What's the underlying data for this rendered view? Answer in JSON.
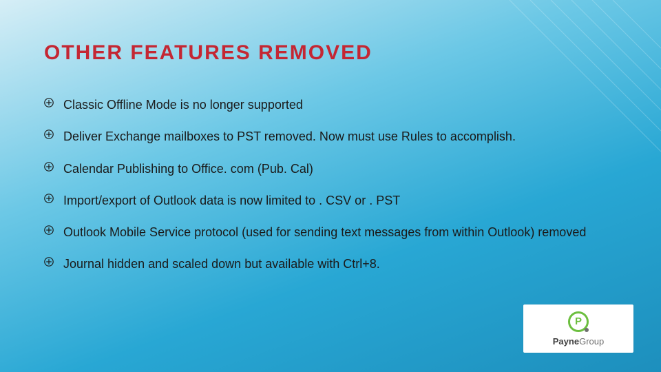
{
  "slide": {
    "title": "OTHER FEATURES REMOVED",
    "bullets": [
      "Classic Offline Mode is no longer supported",
      "Deliver Exchange mailboxes to PST removed. Now must use Rules to accomplish.",
      "Calendar Publishing to Office. com (Pub. Cal)",
      "Import/export of Outlook data is now limited to . CSV or  . PST",
      "Outlook Mobile Service protocol (used for sending text messages from within Outlook) removed",
      "Journal hidden and scaled down but available with Ctrl+8."
    ]
  },
  "logo": {
    "brand_first": "Payne",
    "brand_second": "Group"
  }
}
